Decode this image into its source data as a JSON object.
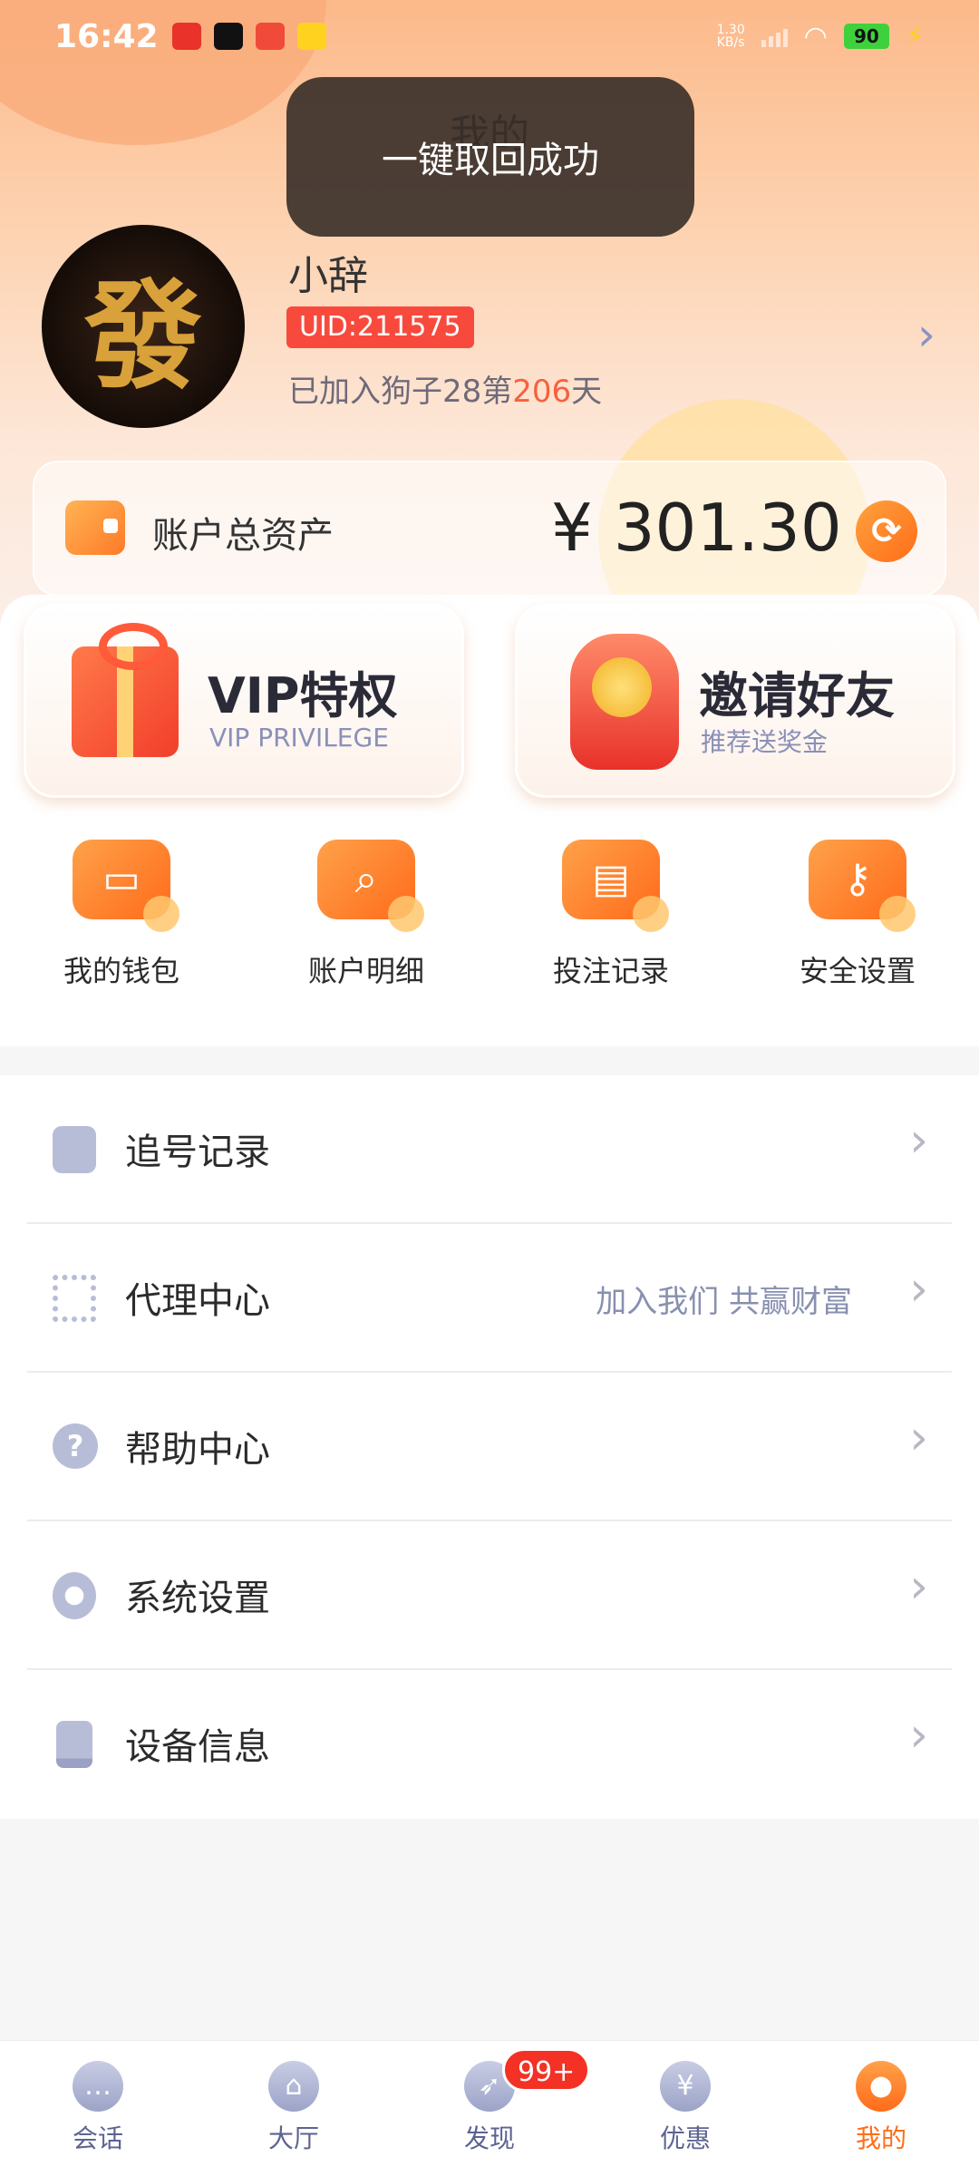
{
  "status_bar": {
    "time": "16:42",
    "net_speed_value": "1.30",
    "net_speed_unit": "KB/s",
    "battery": "90"
  },
  "page_title": "我的",
  "toast": "一键取回成功",
  "profile": {
    "avatar_char": "發",
    "username": "小辞",
    "uid": "UID:211575",
    "joined_prefix": "已加入狗子28第",
    "joined_days": "206",
    "joined_suffix": "天"
  },
  "assets": {
    "label": "账户总资产",
    "amount": "¥ 301.30"
  },
  "promos": [
    {
      "title": "VIP特权",
      "subtitle": "VIP PRIVILEGE"
    },
    {
      "title": "邀请好友",
      "subtitle": "推荐送奖金"
    }
  ],
  "quick_actions": [
    {
      "label": "我的钱包",
      "icon": "wallet-icon"
    },
    {
      "label": "账户明细",
      "icon": "magnifier-icon"
    },
    {
      "label": "投注记录",
      "icon": "calendar-icon"
    },
    {
      "label": "安全设置",
      "icon": "key-icon"
    }
  ],
  "menu": [
    {
      "label": "追号记录",
      "sub": "",
      "icon": "document-icon"
    },
    {
      "label": "代理中心",
      "sub": "加入我们 共赢财富",
      "icon": "qr-code-icon"
    },
    {
      "label": "帮助中心",
      "sub": "",
      "icon": "help-icon"
    },
    {
      "label": "系统设置",
      "sub": "",
      "icon": "gear-icon"
    },
    {
      "label": "设备信息",
      "sub": "",
      "icon": "device-icon"
    }
  ],
  "nav": [
    {
      "label": "会话",
      "icon": "chat-icon"
    },
    {
      "label": "大厅",
      "icon": "hall-icon"
    },
    {
      "label": "发现",
      "icon": "compass-icon",
      "badge": "99+"
    },
    {
      "label": "优惠",
      "icon": "coupon-icon"
    },
    {
      "label": "我的",
      "icon": "profile-icon",
      "active": true
    }
  ],
  "colors": {
    "accent": "#ff6d18",
    "uid_badge": "#f74a3d",
    "days_highlight": "#f7603e"
  }
}
